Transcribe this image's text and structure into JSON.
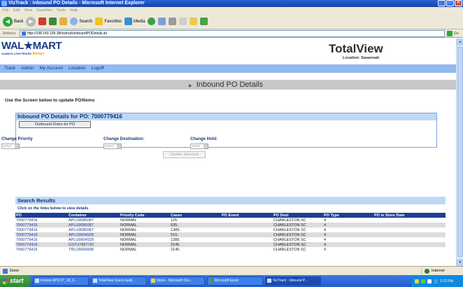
{
  "window": {
    "title": "VizTrack : Inbound PO Details - Microsoft Internet Explorer",
    "buttons": [
      "minimize",
      "maximize",
      "close"
    ]
  },
  "menubar": [
    "File",
    "Edit",
    "View",
    "Favorites",
    "Tools",
    "Help"
  ],
  "toolbar": {
    "back_label": "Back",
    "search_label": "Search",
    "favorites_label": "Favorites",
    "media_label": "Media"
  },
  "address": {
    "label": "Address",
    "url": "http://198.143.199.38/viztrack/inboundPODetails.do",
    "go_label": "Go"
  },
  "header": {
    "logo_text": "WAL★MART",
    "logo_tagline": "ALWAYS LOW PRICES",
    "logo_always": "Always",
    "app_title": "TotalView",
    "location": "Location: Savannah"
  },
  "nav": [
    "Track",
    "Admin",
    "My Account",
    "Location",
    "Logoff"
  ],
  "page": {
    "heading": "Inbound PO Details",
    "instruction": "Use the Screen below to update PO/Items"
  },
  "po_details": {
    "title": "Inbound PO Details for PO: 7000779416",
    "outbound_button": "Outbound Distro for PO",
    "change_priority": "Change Priority",
    "change_destination": "Change Destination:",
    "change_hold": "Change Hold:",
    "select_placeholder": "Select",
    "update_button": "Update Selected"
  },
  "results": {
    "title": "Search Results",
    "subtitle": "Click on the links below to view details",
    "columns": [
      "PO",
      "Container",
      "Priority Code",
      "Cases",
      "PO Event",
      "PO Dest",
      "PO Type",
      "PO in Store Date"
    ],
    "rows": [
      [
        "7000779416",
        "APLU9085087",
        "NORMAL",
        "125.",
        "",
        "CHARLESTON SC",
        "4",
        ""
      ],
      [
        "7000779416",
        "APLU9085087",
        "NORMAL",
        "635.",
        "",
        "CHARLESTON SC",
        "4",
        ""
      ],
      [
        "7000779416",
        "APLU9085087",
        "NORMAL",
        "1389.",
        "",
        "CHARLESTON SC",
        "4",
        ""
      ],
      [
        "7000779416",
        "APLU9904528",
        "NORMAL",
        "510.",
        "",
        "CHARLESTON SC",
        "4",
        ""
      ],
      [
        "7000779416",
        "APLU9904528",
        "NORMAL",
        "1389.",
        "",
        "CHARLESTON SC",
        "4",
        ""
      ],
      [
        "7000779416",
        "GSTU7867787",
        "NORMAL",
        "2145.",
        "",
        "CHARLESTON SC",
        "4",
        ""
      ],
      [
        "7000779416",
        "TRLU5660998",
        "NORMAL",
        "2145.",
        "",
        "CHARLESTON SC",
        "4",
        ""
      ]
    ]
  },
  "statusbar": {
    "status": "Done",
    "zone": "Internet"
  },
  "taskbar": {
    "start_label": "start",
    "tasks": [
      {
        "label": "Invoice APS 07_18_0...",
        "active": false
      },
      {
        "label": "TotalView Users Guid...",
        "active": false
      },
      {
        "label": "Inbox - Microsoft Out...",
        "active": false
      },
      {
        "label": "Microsoft Excel",
        "active": false
      },
      {
        "label": "VizTrack : Inbound P...",
        "active": true
      }
    ],
    "clock": "1:22 PM"
  },
  "colors": {
    "nav_bg": "#92baf0",
    "table_header": "#1b3f95",
    "panel_header": "#bfd8f6",
    "title_bar": "#2a63d8"
  }
}
